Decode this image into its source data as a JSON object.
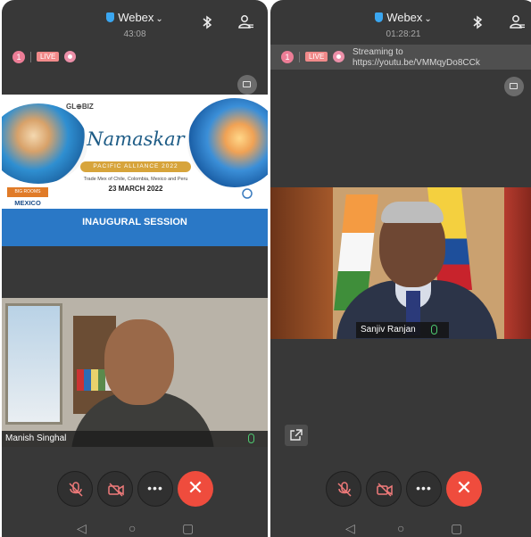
{
  "left_phone": {
    "app_name": "Webex",
    "call_timer": "43:08",
    "participant_count": "1",
    "live_label": "LIVE",
    "slide": {
      "logo_text": "GL⊕BIZ",
      "title": "Namaskar",
      "ribbon": "PACIFIC ALLIANCE 2022",
      "subline": "Trade Mex of Chile, Colombia, Mexico and Peru",
      "date": "23 MARCH 2022",
      "country_tag": "BIG ROOMS",
      "country": "MEXICO",
      "session": "INAUGURAL SESSION"
    },
    "participant_name": "Manish Singhal"
  },
  "right_phone": {
    "app_name": "Webex",
    "call_timer": "01:28:21",
    "participant_count": "1",
    "live_label": "LIVE",
    "streaming_text": "Streaming to https://youtu.be/VMMqyDo8CCk",
    "participant_name": "Sanjiv Ranjan"
  },
  "colors": {
    "background": "#383838",
    "end_call": "#ef4c3d",
    "live_badge": "#f18a8a",
    "session_bar": "#2a78c6",
    "mic_active": "#4ecb71"
  },
  "icons": {
    "app": "webex-shield-icon",
    "bluetooth": "bluetooth-icon",
    "participants": "participants-icon",
    "recording": "record-icon",
    "layout": "layout-toggle-icon",
    "mute": "mic-muted-icon",
    "video": "video-off-icon",
    "more": "more-icon",
    "end": "end-call-icon",
    "share": "share-screen-icon"
  }
}
